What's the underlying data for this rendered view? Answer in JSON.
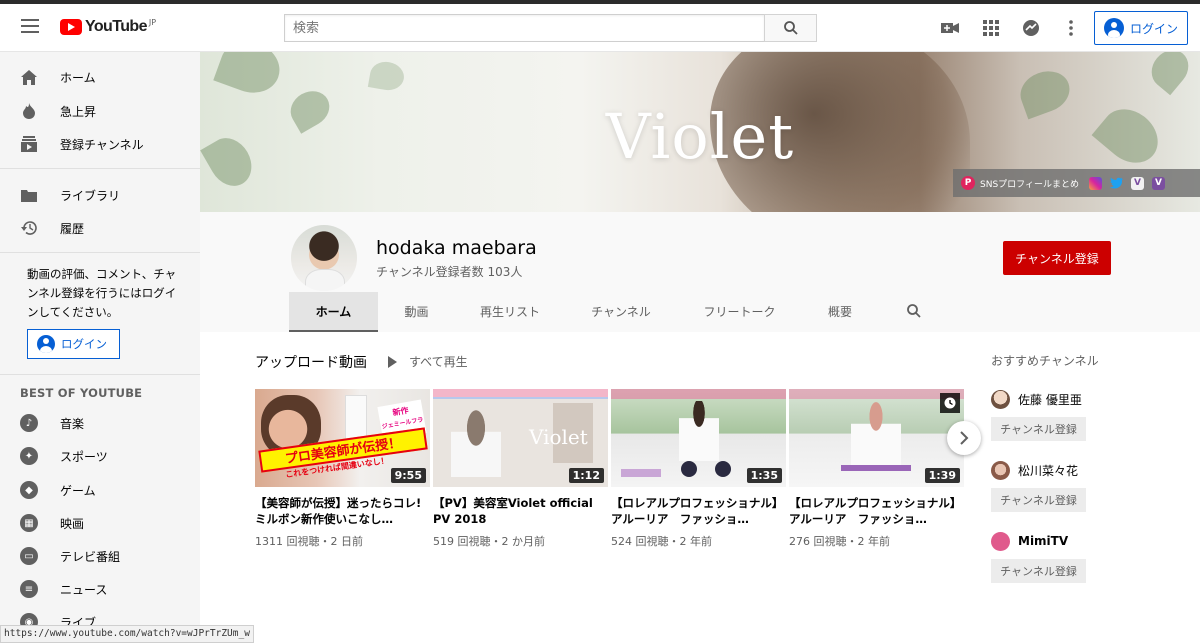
{
  "header": {
    "logo_text": "YouTube",
    "logo_region": "JP",
    "search_placeholder": "検索",
    "login_label": "ログイン",
    "icons": [
      "menu-icon",
      "video-camera-icon",
      "apps-grid-icon",
      "messages-icon",
      "more-vert-icon",
      "search-icon"
    ]
  },
  "sidebar": {
    "items": [
      {
        "label": "ホーム",
        "icon": "home-icon"
      },
      {
        "label": "急上昇",
        "icon": "flame-icon"
      },
      {
        "label": "登録チャンネル",
        "icon": "subscriptions-icon"
      },
      {
        "label": "ライブラリ",
        "icon": "folder-icon"
      },
      {
        "label": "履歴",
        "icon": "history-icon"
      }
    ],
    "signin_message": "動画の評価、コメント、チャンネル登録を行うにはログインしてください。",
    "login_label": "ログイン",
    "best_heading": "BEST OF YOUTUBE",
    "best_items": [
      {
        "label": "音楽",
        "icon": "music-icon"
      },
      {
        "label": "スポーツ",
        "icon": "sports-icon"
      },
      {
        "label": "ゲーム",
        "icon": "gaming-icon"
      },
      {
        "label": "映画",
        "icon": "movies-icon"
      },
      {
        "label": "テレビ番組",
        "icon": "tv-icon"
      },
      {
        "label": "ニュース",
        "icon": "news-icon"
      },
      {
        "label": "ライブ",
        "icon": "live-icon"
      }
    ]
  },
  "banner": {
    "title": "Violet",
    "links_label": "SNSプロフィールまとめ",
    "link_p": "P",
    "link_v": "V"
  },
  "channel": {
    "name": "hodaka maebara",
    "subscribers": "チャンネル登録者数 103人",
    "subscribe_label": "チャンネル登録",
    "tabs": [
      "ホーム",
      "動画",
      "再生リスト",
      "チャンネル",
      "フリートーク",
      "概要"
    ],
    "active_tab": "ホーム"
  },
  "uploads": {
    "title": "アップロード動画",
    "play_all": "すべて再生",
    "videos": [
      {
        "title": "【美容師が伝授】迷ったらコレ!ミルボン新作使いこなし…",
        "views": "1311 回視聴・2 日前",
        "duration": "9:55",
        "thumb_text_1": "新作",
        "thumb_text_2": "ジェミールフラン",
        "thumb_text_3": "プロ美容師が伝授！",
        "thumb_text_4": "これをつければ間違いなし！"
      },
      {
        "title": "【PV】美容室Violet official PV 2018",
        "views": "519 回視聴・2 か月前",
        "duration": "1:12",
        "thumb_text_1": "Violet"
      },
      {
        "title": "【ロレアルプロフェッショナル】アルーリア　ファッショ…",
        "views": "524 回視聴・2 年前",
        "duration": "1:35"
      },
      {
        "title": "【ロレアルプロフェッショナル】アルーリア　ファッショ…",
        "views": "276 回視聴・2 年前",
        "duration": "1:39"
      }
    ]
  },
  "recommended": {
    "title": "おすすめチャンネル",
    "channels": [
      {
        "name": "佐藤 優里亜",
        "button": "チャンネル登録",
        "color": "#e8cdb9"
      },
      {
        "name": "松川菜々花",
        "button": "チャンネル登録",
        "color": "#c89a86"
      },
      {
        "name": "MimiTV",
        "button": "チャンネル登録",
        "color": "#e05a8c"
      }
    ]
  },
  "status_bar": {
    "url": "https://www.youtube.com/watch?v=wJPrTrZUm_w"
  },
  "colors": {
    "brand_red": "#ff0000",
    "subscribe_red": "#cc0000",
    "link_blue": "#065fd4"
  }
}
